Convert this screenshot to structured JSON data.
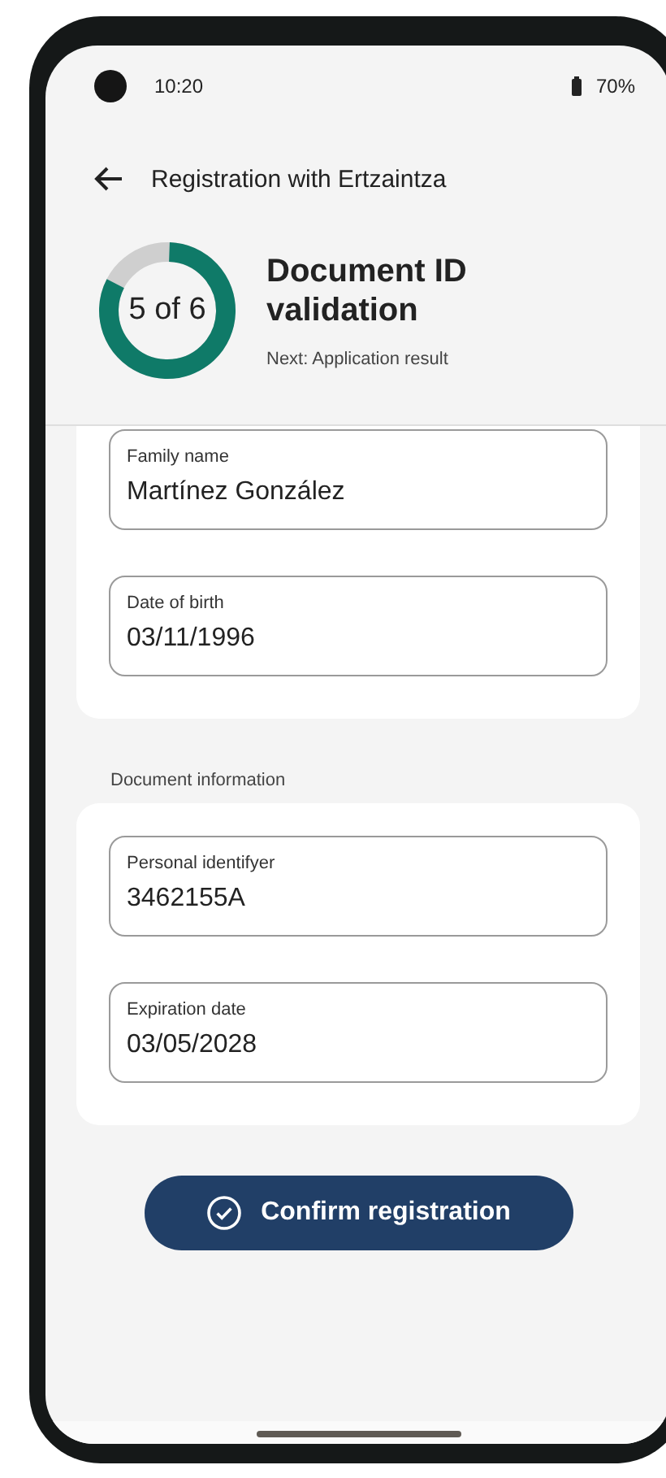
{
  "status_bar": {
    "time": "10:20",
    "battery": "70%"
  },
  "header": {
    "title": "Registration with Ertzaintza"
  },
  "progress": {
    "label": "5 of 6",
    "level": 0.833,
    "title": "Document ID validation",
    "next": "Next: Application result"
  },
  "sections": [
    {
      "fields": [
        {
          "label": "Family name",
          "value": "Martínez González"
        },
        {
          "label": "Date of birth",
          "value": "03/11/1996"
        }
      ]
    },
    {
      "heading": "Document information",
      "fields": [
        {
          "label": "Personal identifyer",
          "value": "3462155A"
        },
        {
          "label": "Expiration date",
          "value": "03/05/2028"
        }
      ]
    }
  ],
  "button": {
    "label": "Confirm registration"
  }
}
